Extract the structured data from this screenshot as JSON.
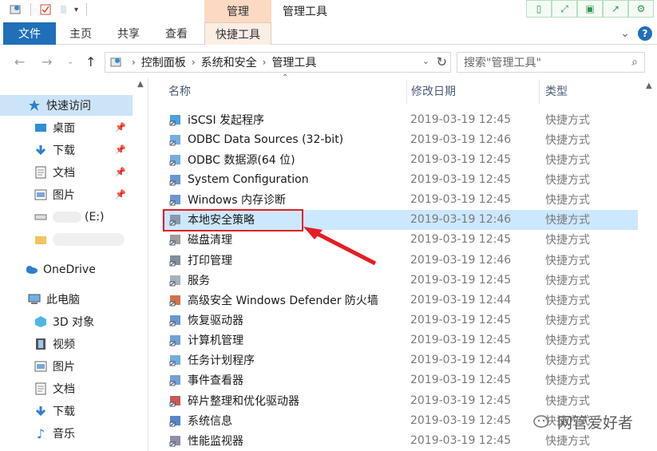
{
  "titlebar": {
    "context_tab": "管理",
    "window_title": "管理工具"
  },
  "ribbon": {
    "tabs": [
      {
        "label": "文件"
      },
      {
        "label": "主页"
      },
      {
        "label": "共享"
      },
      {
        "label": "查看"
      },
      {
        "label": "快捷工具"
      }
    ]
  },
  "address": {
    "crumbs": [
      "控制面板",
      "系统和安全",
      "管理工具"
    ],
    "search_placeholder": "搜索\"管理工具\""
  },
  "sidebar": {
    "items": [
      {
        "label": "快速访问",
        "icon": "star-icon"
      },
      {
        "label": "桌面",
        "icon": "desktop-icon"
      },
      {
        "label": "下载",
        "icon": "download-icon"
      },
      {
        "label": "文档",
        "icon": "document-icon"
      },
      {
        "label": "图片",
        "icon": "picture-icon"
      },
      {
        "label": "(E:)",
        "icon": "drive-icon"
      },
      {
        "label": "",
        "icon": "folder-icon"
      },
      {
        "label": "OneDrive",
        "icon": "cloud-icon"
      },
      {
        "label": "此电脑",
        "icon": "computer-icon"
      },
      {
        "label": "3D 对象",
        "icon": "cube-icon"
      },
      {
        "label": "视频",
        "icon": "video-icon"
      },
      {
        "label": "图片",
        "icon": "picture-icon"
      },
      {
        "label": "文档",
        "icon": "document-icon"
      },
      {
        "label": "下载",
        "icon": "download-icon"
      },
      {
        "label": "音乐",
        "icon": "music-icon"
      }
    ]
  },
  "columns": {
    "name": "名称",
    "date": "修改日期",
    "type": "类型"
  },
  "files": [
    {
      "name": "iSCSI 发起程序",
      "date": "2019-03-19 12:45",
      "type": "快捷方式"
    },
    {
      "name": "ODBC Data Sources (32-bit)",
      "date": "2019-03-19 12:46",
      "type": "快捷方式"
    },
    {
      "name": "ODBC 数据源(64 位)",
      "date": "2019-03-19 12:45",
      "type": "快捷方式"
    },
    {
      "name": "System Configuration",
      "date": "2019-03-19 12:45",
      "type": "快捷方式"
    },
    {
      "name": "Windows 内存诊断",
      "date": "2019-03-19 12:45",
      "type": "快捷方式"
    },
    {
      "name": "本地安全策略",
      "date": "2019-03-19 12:46",
      "type": "快捷方式"
    },
    {
      "name": "磁盘清理",
      "date": "2019-03-19 12:45",
      "type": "快捷方式"
    },
    {
      "name": "打印管理",
      "date": "2019-03-19 12:46",
      "type": "快捷方式"
    },
    {
      "name": "服务",
      "date": "2019-03-19 12:45",
      "type": "快捷方式"
    },
    {
      "name": "高级安全 Windows Defender 防火墙",
      "date": "2019-03-19 12:44",
      "type": "快捷方式"
    },
    {
      "name": "恢复驱动器",
      "date": "2019-03-19 12:45",
      "type": "快捷方式"
    },
    {
      "name": "计算机管理",
      "date": "2019-03-19 12:45",
      "type": "快捷方式"
    },
    {
      "name": "任务计划程序",
      "date": "2019-03-19 12:44",
      "type": "快捷方式"
    },
    {
      "name": "事件查看器",
      "date": "2019-03-19 12:45",
      "type": "快捷方式"
    },
    {
      "name": "碎片整理和优化驱动器",
      "date": "2019-03-19 12:45",
      "type": "快捷方式"
    },
    {
      "name": "系统信息",
      "date": "2019-03-19 12:45",
      "type": "快捷方式"
    },
    {
      "name": "性能监视器",
      "date": "2019-03-19 12:45",
      "type": "快捷方式"
    }
  ],
  "watermark": "网管爱好者"
}
